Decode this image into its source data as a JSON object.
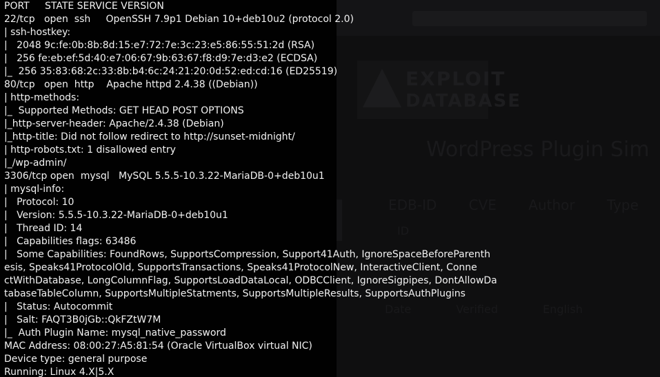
{
  "terminal": {
    "lines": [
      "PORT     STATE SERVICE VERSION",
      "22/tcp   open  ssh     OpenSSH 7.9p1 Debian 10+deb10u2 (protocol 2.0)",
      "| ssh-hostkey:",
      "|   2048 9c:fe:0b:8b:8d:15:e7:72:7e:3c:23:e5:86:55:51:2d (RSA)",
      "|   256 fe:eb:ef:5d:40:e7:06:67:9b:63:67:f8:d9:7e:d3:e2 (ECDSA)",
      "|_  256 35:83:68:2c:33:8b:b4:6c:24:21:20:0d:52:ed:cd:16 (ED25519)",
      "80/tcp   open  http    Apache httpd 2.4.38 ((Debian))",
      "| http-methods:",
      "|_  Supported Methods: GET HEAD POST OPTIONS",
      "|_http-server-header: Apache/2.4.38 (Debian)",
      "|_http-title: Did not follow redirect to http://sunset-midnight/",
      "| http-robots.txt: 1 disallowed entry",
      "|_/wp-admin/",
      "3306/tcp open  mysql   MySQL 5.5.5-10.3.22-MariaDB-0+deb10u1",
      "| mysql-info:",
      "|   Protocol: 10",
      "|   Version: 5.5.5-10.3.22-MariaDB-0+deb10u1",
      "|   Thread ID: 14",
      "|   Capabilities flags: 63486",
      "|   Some Capabilities: FoundRows, SupportsCompression, Support41Auth, IgnoreSpaceBeforeParenth",
      "esis, Speaks41ProtocolOld, SupportsTransactions, Speaks41ProtocolNew, InteractiveClient, Conne",
      "ctWithDatabase, LongColumnFlag, SupportsLoadDataLocal, ODBCClient, IgnoreSigpipes, DontAllowDa",
      "tabaseTableColumn, SupportsMultipleStatments, SupportsMultipleResults, SupportsAuthPlugins",
      "|   Status: Autocommit",
      "|   Salt: FAQT3B0jGb::QkFZtW7M",
      "|_  Auth Plugin Name: mysql_native_password",
      "MAC Address: 08:00:27:A5:81:54 (Oracle VirtualBox virtual NIC)",
      "Device type: general purpose",
      "Running: Linux 4.X|5.X"
    ]
  },
  "background_window": {
    "logo_line1": "EXPLOIT",
    "logo_line2": "DATABASE",
    "heading": "WordPress Plugin Sim",
    "columns": "EDB-ID CVE Author Type",
    "id_value": "ID",
    "row_text": "Date Verified English"
  },
  "colors": {
    "background": "#010101",
    "text": "#f2f2f2"
  }
}
